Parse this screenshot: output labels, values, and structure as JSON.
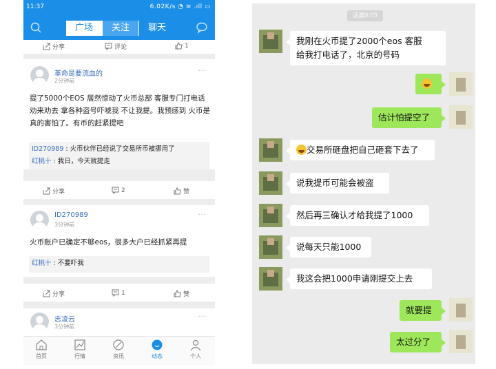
{
  "left": {
    "status": {
      "time": "11:37",
      "network": "6.02K/s ◔ ≋ .ıll ▭"
    },
    "tabs": [
      "广场",
      "关注",
      "聊天"
    ],
    "top_actions": {
      "share": "分享",
      "comment": "评论",
      "like": "1"
    },
    "posts": [
      {
        "user": "革命是要流血的",
        "time": "2分钟前",
        "text": "提了5000个EOS 居然惊动了火币总部 客服专门打电话 劝来劝去 拿各种盗号吓唬我 不让我提。我预感到 火币是真的害怕了。有币的赶紧提吧",
        "comments": [
          {
            "name": "ID270989",
            "text": " : 火币伙伴已经说了交易所币被挪用了"
          },
          {
            "name": "红桃十",
            "text": " : 我日，今天就提走"
          }
        ],
        "share": "分享",
        "comment_count": "2",
        "like": "赞"
      },
      {
        "user": "ID270989",
        "time": "3分钟前",
        "text": "火币账户已确定不够eos，很多大户已经抓紧再提",
        "comments": [
          {
            "name": "红桃十",
            "text": " : 不要吓我"
          }
        ],
        "share": "分享",
        "comment_count": "1",
        "like": "赞"
      },
      {
        "user": "志凌云",
        "time": "3分钟前"
      }
    ],
    "more": "···",
    "bottom_nav": [
      "首页",
      "行情",
      "资讯",
      "动态",
      "个人"
    ]
  },
  "chat": {
    "timestamp": "凌晨0:05",
    "messages": [
      {
        "side": "in",
        "lines": [
          "我刚在火币提了2000个eos 客服",
          "给我打电话了，北京的号码"
        ]
      },
      {
        "side": "out",
        "emoji": "laughing-emoji"
      },
      {
        "side": "out",
        "text": "估计怕提空了"
      },
      {
        "side": "in",
        "emoji": "grinning-emoji",
        "text": "交易所砸盘把自己砸套下去了"
      },
      {
        "side": "in",
        "text": "说我提币可能会被盗"
      },
      {
        "side": "in",
        "text": "然后再三确认才给我提了1000"
      },
      {
        "side": "in",
        "text": "说每天只能1000"
      },
      {
        "side": "in",
        "text": "我这会把1000申请刚提交上去"
      },
      {
        "side": "out",
        "text": "就要提"
      },
      {
        "side": "out",
        "text": "太过分了"
      }
    ]
  },
  "colors": {
    "brand_blue": "#1b8fe7",
    "chat_green": "#9ee75a",
    "link_blue": "#3a6fc3"
  }
}
